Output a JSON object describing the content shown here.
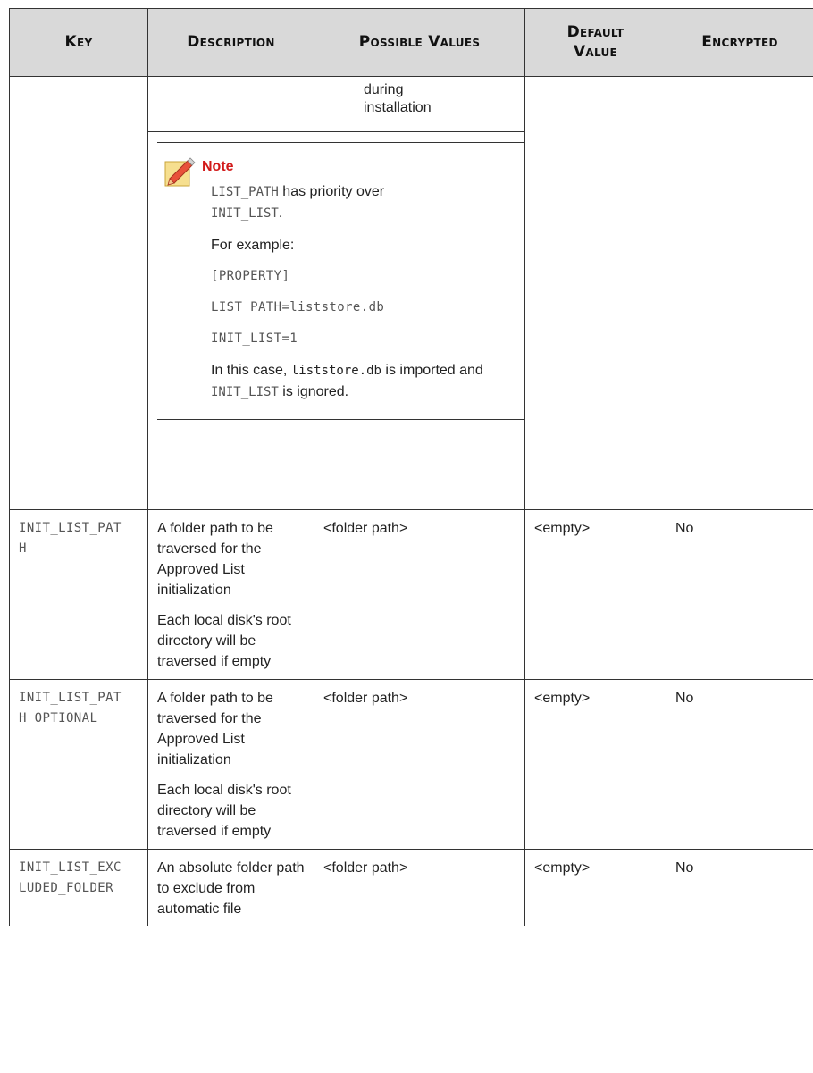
{
  "headers": {
    "key": "Key",
    "description": "Description",
    "possible_values": "Possible Values",
    "default_value_line1": "Default",
    "default_value_line2": "Value",
    "encrypted": "Encrypted"
  },
  "continuation": {
    "possible_values_line1": "during",
    "possible_values_line2": "installation"
  },
  "note": {
    "icon": "note-pencil-icon",
    "title": "Note",
    "p1_code1": "LIST_PATH",
    "p1_text": " has priority over ",
    "p1_code2": "INIT_LIST",
    "p1_end": ".",
    "p2": "For example:",
    "code_line1": "[PROPERTY]",
    "code_line2": "LIST_PATH=liststore.db",
    "code_line3": "INIT_LIST=1",
    "p6_start": "In this case, ",
    "p6_code1": "liststore.db",
    "p6_mid": " is imported and ",
    "p6_code2": "INIT_LIST",
    "p6_end": " is ignored."
  },
  "rows": [
    {
      "key": "INIT_LIST_PATH",
      "desc1": "A folder path to be traversed for the Approved List initialization",
      "desc2": "Each local disk's root directory will be traversed if empty",
      "possible": "<folder path>",
      "default": "<empty>",
      "encrypted": "No"
    },
    {
      "key": "INIT_LIST_PATH_OPTIONAL",
      "desc1": "A folder path to be traversed for the Approved List initialization",
      "desc2": "Each local disk's root directory will be traversed if empty",
      "possible": "<folder path>",
      "default": "<empty>",
      "encrypted": "No"
    },
    {
      "key": "INIT_LIST_EXCLUDED_FOLDER",
      "desc1": "An absolute folder path to exclude from automatic file",
      "possible": "<folder path>",
      "default": "<empty>",
      "encrypted": "No"
    }
  ]
}
